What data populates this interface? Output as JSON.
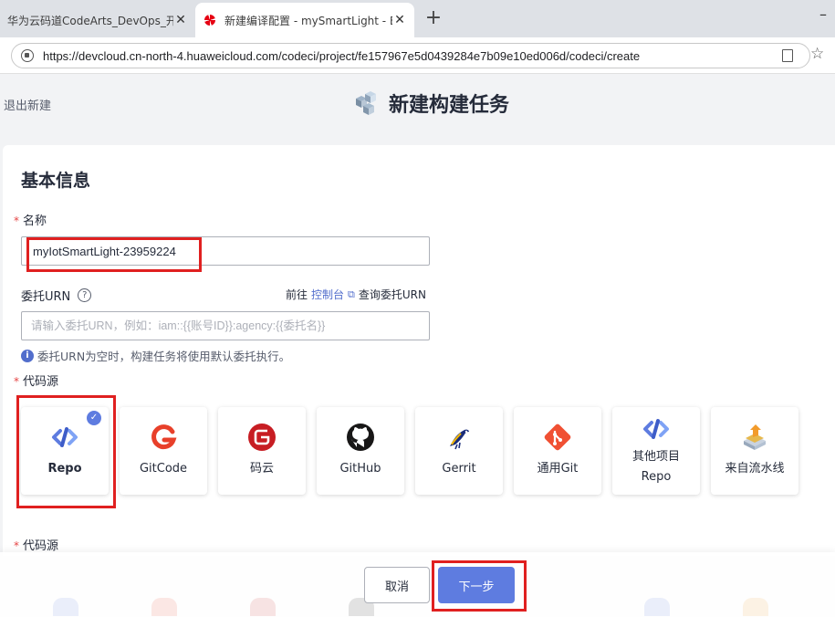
{
  "browser": {
    "tabs": [
      {
        "title": "华为云码道CodeArts_DevOps_开发",
        "active": false
      },
      {
        "title": "新建编译配置 - mySmartLight - Bu",
        "active": true
      }
    ],
    "new_tab": "+",
    "minimize": "–",
    "url": "https://devcloud.cn-north-4.huaweicloud.com/codeci/project/fe157967e5d0439284e7b09e10ed006d/codeci/create",
    "close_glyph": "✕",
    "star_glyph": "☆"
  },
  "header": {
    "exit_label": "退出新建",
    "title": "新建构建任务"
  },
  "form": {
    "section_title": "基本信息",
    "required_mark": "*",
    "name_label": "名称",
    "name_value": "myIotSmartLight-23959224",
    "urn_label": "委托URN",
    "help_glyph": "?",
    "goto_prefix": "前往",
    "console_link": "控制台",
    "query_urn": "查询委托URN",
    "urn_placeholder": "请输入委托URN，例如：iam::{{账号ID}}:agency:{{委托名}}",
    "info_glyph": "i",
    "urn_info": "委托URN为空时，构建任务将使用默认委托执行。",
    "source_label": "代码源",
    "source_label_repeat": "代码源",
    "check_glyph": "✓"
  },
  "sources": [
    {
      "label": "Repo",
      "icon": "repo-icon",
      "selected": true
    },
    {
      "label": "GitCode",
      "icon": "gitcode-icon",
      "selected": false
    },
    {
      "label": "码云",
      "icon": "gitee-icon",
      "selected": false
    },
    {
      "label": "GitHub",
      "icon": "github-icon",
      "selected": false
    },
    {
      "label": "Gerrit",
      "icon": "gerrit-icon",
      "selected": false
    },
    {
      "label": "通用Git",
      "icon": "git-icon",
      "selected": false
    },
    {
      "label_line1": "其他项目",
      "label_line2": "Repo",
      "icon": "repo-icon",
      "selected": false
    },
    {
      "label": "来自流水线",
      "icon": "pipeline-icon",
      "selected": false
    }
  ],
  "footer": {
    "cancel_label": "取消",
    "next_label": "下一步"
  },
  "colors": {
    "accent": "#5e7ce0",
    "annotation": "#e02020",
    "required": "#e54545"
  }
}
